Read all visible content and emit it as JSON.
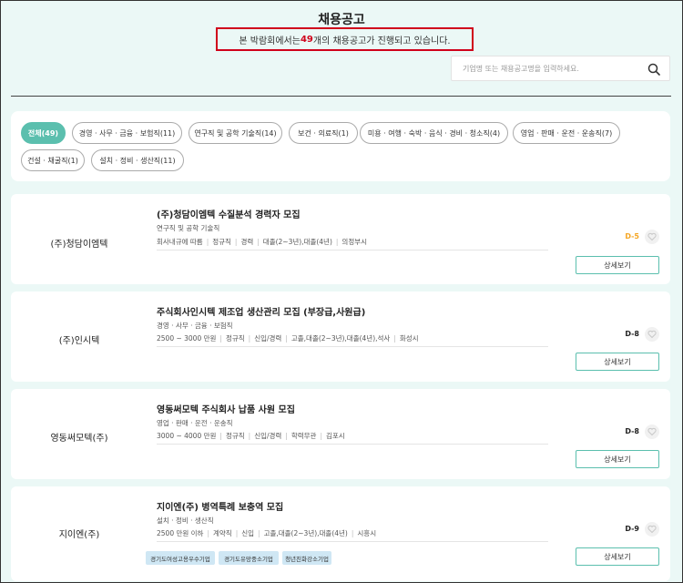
{
  "header": {
    "title": "채용공고",
    "notice_prefix": "본 박람회에서는 ",
    "notice_count": "49",
    "notice_suffix": "개의 채용공고가 진행되고 있습니다."
  },
  "search": {
    "placeholder": "기업명 또는 채용공고명을 입력하세요.",
    "value": ""
  },
  "filters": [
    {
      "label": "전체(49)",
      "active": true
    },
    {
      "label": "경영 · 사무 · 금융 · 보험직(11)",
      "active": false
    },
    {
      "label": "연구직 및 공학 기술직(14)",
      "active": false
    },
    {
      "label": "보건 · 의료직(1)",
      "active": false
    },
    {
      "label": "미용 · 여행 · 숙박 · 음식 · 경비 · 청소직(4)",
      "active": false
    },
    {
      "label": "영업 · 판매 · 운전 · 운송직(7)",
      "active": false
    },
    {
      "label": "건설 · 채굴직(1)",
      "active": false
    },
    {
      "label": "설치 · 정비 · 생산직(11)",
      "active": false
    }
  ],
  "jobs": [
    {
      "company": "(주)청담이엠텍",
      "title": "(주)청담이엠텍 수질분석 경력자 모집",
      "category": "연구직 및 공학 기술직",
      "meta": [
        "회사내규에 따름",
        "정규직",
        "경력",
        "대졸(2~3년),대졸(4년)",
        "의정부시"
      ],
      "dday": "D-5",
      "detail_label": "상세보기",
      "tags": []
    },
    {
      "company": "(주)인시텍",
      "title": "주식회사인시텍 제조업 생산관리 모집 (부장급,사원급)",
      "category": "경영 · 사무 · 금융 · 보험직",
      "meta": [
        "2500 ~ 3000 만원",
        "정규직",
        "신입/경력",
        "고졸,대졸(2~3년),대졸(4년),석사",
        "화성시"
      ],
      "dday": "D-8",
      "detail_label": "상세보기",
      "tags": []
    },
    {
      "company": "영동써모텍(주)",
      "title": "영동써모텍 주식회사 납품 사원 모집",
      "category": "영업 · 판매 · 운전 · 운송직",
      "meta": [
        "3000 ~ 4000 만원",
        "정규직",
        "신입/경력",
        "학력무관",
        "김포시"
      ],
      "dday": "D-8",
      "detail_label": "상세보기",
      "tags": []
    },
    {
      "company": "지이엔(주)",
      "title": "지이엔(주) 병역특례 보충역 모집",
      "category": "설치 · 정비 · 생산직",
      "meta": [
        "2500 만원 이하",
        "계약직",
        "신입",
        "고졸,대졸(2~3년),대졸(4년)",
        "시흥시"
      ],
      "dday": "D-9",
      "detail_label": "상세보기",
      "tags": [
        "경기도여성고용우수기업",
        "경기도유망중소기업",
        "청년친화강소기업"
      ]
    }
  ],
  "colors": {
    "accent": "#5bbfae",
    "highlight_red": "#d0021b",
    "urgent": "#f5a623",
    "background": "#ebf8f6",
    "tag_bg": "#cfe7f4"
  }
}
